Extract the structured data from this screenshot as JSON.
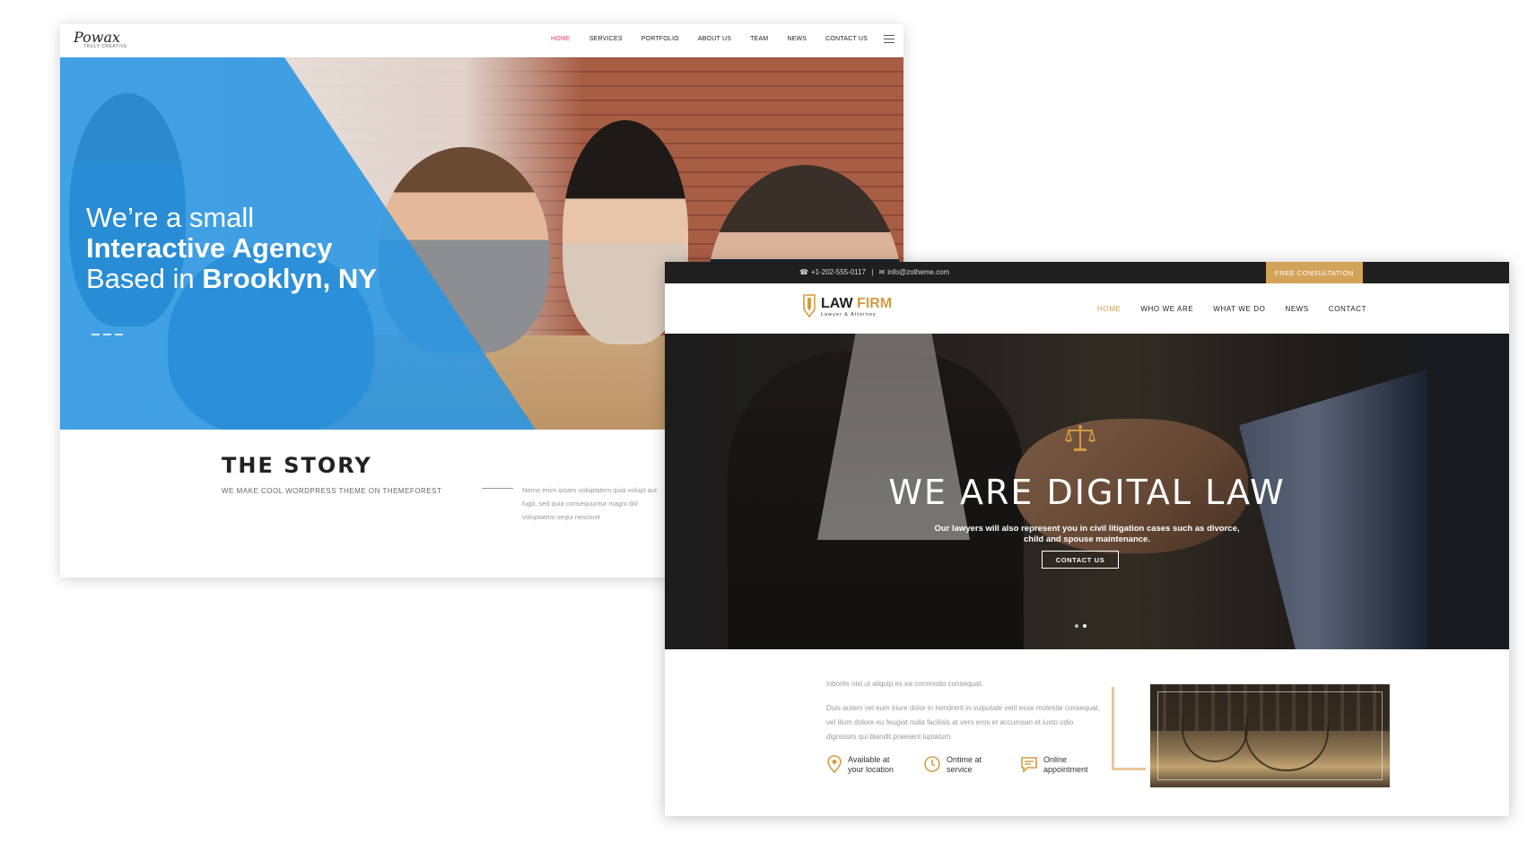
{
  "powax": {
    "logo": "Powax",
    "tagline": "TRULY CREATIVE",
    "nav": [
      "HOME",
      "SERVICES",
      "PORTFOLIO",
      "ABOUT US",
      "TEAM",
      "NEWS",
      "CONTACT US"
    ],
    "hero": {
      "line1": "We’re a small",
      "line2": "Interactive Agency",
      "line3_prefix": "Based in ",
      "line3_bold": "Brooklyn, NY"
    },
    "story": {
      "title": "THE STORY",
      "subtitle": "WE MAKE COOL WORDPRESS THEME ON THEMEFOREST",
      "body": "Nemo enim ipsam voluptatem quia volupt aut fugit, sed quia consequuntur magni dol voluptatem sequi nesciunt"
    }
  },
  "lawfirm": {
    "topbar": {
      "phone": "+1-202-555-0117",
      "separator": "|",
      "email": "info@zotheme.com",
      "cta": "FREE CONSULTATION"
    },
    "logo": {
      "word1": "LAW",
      "word2": "FIRM",
      "sub": "Lawyer & Attorney"
    },
    "nav": [
      "HOME",
      "WHO WE ARE",
      "WHAT WE DO",
      "NEWS",
      "CONTACT"
    ],
    "hero": {
      "title": "WE ARE DIGITAL LAW",
      "text": "Our lawyers will also represent you in civil litigation cases such as divorce, child and spouse maintenance.",
      "button": "CONTACT US"
    },
    "about": {
      "p1": "lobortis nisl ut aliquip ex ea commodo consequat.",
      "p2": "Duis autem vel eum iriure dolor in hendrerit in vulputate velit esse molestie consequat, vel illum dolore eu feugiat nulla facilisis at vero eros et accumsan et iusto odio dignissim qui blandit praesent luptatum."
    },
    "features": [
      {
        "label": "Available at your location",
        "icon": "location-pin-icon"
      },
      {
        "label": "Ontime at service",
        "icon": "clock-icon"
      },
      {
        "label": "Online appointment",
        "icon": "chat-icon"
      }
    ],
    "colors": {
      "accent": "#d49b45",
      "topbar": "#1f1f1f"
    }
  },
  "colors": {
    "powax_accent": "#e8415c",
    "powax_blue": "#2996e4"
  }
}
